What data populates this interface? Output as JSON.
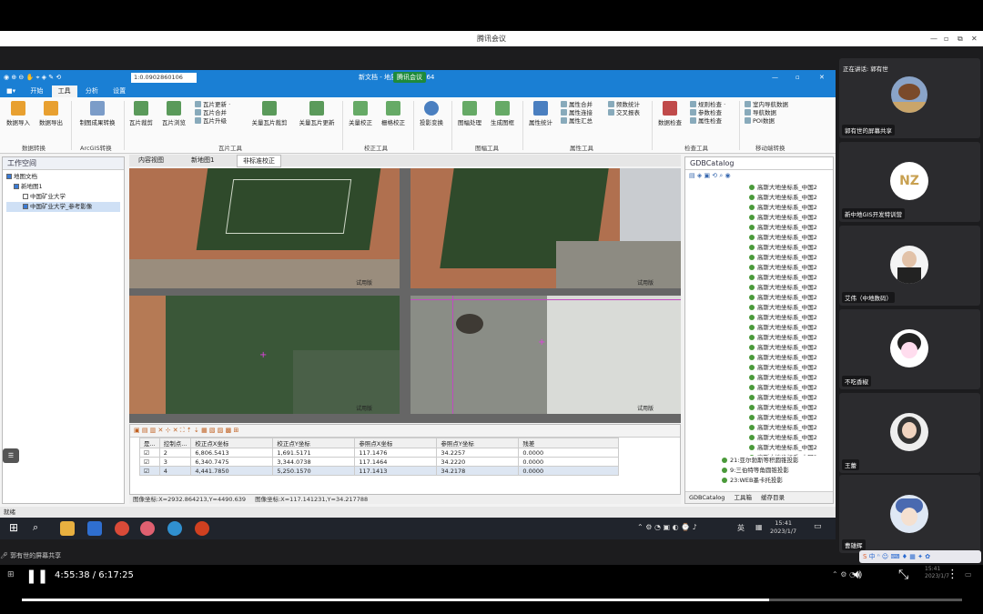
{
  "meeting": {
    "title": "腾讯会议",
    "controls": [
      "—",
      "▫",
      "⧉",
      "✕"
    ]
  },
  "gis": {
    "title": "新文档 - 地质 影像 迅 X64",
    "overlay_badge": "腾讯会议",
    "scale_value": "1:0.0902860106",
    "tabs": [
      "开始",
      "工具",
      "分析",
      "设置"
    ],
    "ribbon": {
      "groups": [
        {
          "label": "数据转换",
          "buttons": [
            "数据导入",
            "数据导出"
          ]
        },
        {
          "label": "ArcGIS转换",
          "buttons": [
            "制图成果转换"
          ]
        },
        {
          "label": "瓦片工具",
          "buttons": [
            "瓦片裁剪",
            "瓦片浏览"
          ],
          "small": [
            "瓦片更新 ·",
            "瓦片合并",
            "瓦片升级"
          ]
        },
        {
          "label": "",
          "buttons": [
            "关量瓦片裁剪",
            "关量瓦片更新"
          ]
        },
        {
          "label": "校正工具",
          "buttons": [
            "关量校正",
            "栅格校正"
          ]
        },
        {
          "label": "",
          "buttons": [
            "投影变换"
          ]
        },
        {
          "label": "图幅工具",
          "buttons": [
            "图幅处理",
            "生成图框"
          ]
        },
        {
          "label": "属性工具",
          "buttons": [
            "属性统计"
          ],
          "small": [
            "属性合并",
            "属性连接",
            "属性汇总"
          ],
          "small2": [
            "频数统计",
            "交叉报表"
          ]
        },
        {
          "label": "检查工具",
          "buttons": [
            "数据检查"
          ],
          "small": [
            "规则检查 ·",
            "参数检查",
            "属性检查"
          ]
        },
        {
          "label": "移动端转换",
          "small": [
            "室内导航数据",
            "导航数据",
            "POI数据"
          ]
        }
      ]
    },
    "workspace": {
      "title": "工作空间",
      "items": [
        "地图文档",
        "新地图1",
        "中国矿业大学",
        "中国矿业大学_参考影像"
      ]
    },
    "doc_tabs": [
      "内容视图",
      "新地图1",
      "非标准校正"
    ],
    "views": {
      "watermark": "试用版"
    },
    "gcp_table": {
      "headers": [
        "是...",
        "控制点...",
        "校正点X坐标",
        "校正点Y坐标",
        "参照点X坐标",
        "参照点Y坐标",
        "残差"
      ],
      "rows": [
        [
          "☑",
          "2",
          "6,806.5413",
          "1,691.5171",
          "117.1476",
          "34.2257",
          "0.0000"
        ],
        [
          "☑",
          "3",
          "6,340.7475",
          "3,344.0738",
          "117.1464",
          "34.2220",
          "0.0000"
        ],
        [
          "☑",
          "4",
          "4,441.7850",
          "5,250.1570",
          "117.1413",
          "34.2178",
          "0.0000"
        ]
      ]
    },
    "coords": {
      "image": "图像坐标:X=2932.864213,Y=4490.639",
      "map": "图像坐标:X=117.141231,Y=34.217788"
    },
    "status": "就绪",
    "catalog": {
      "title": "GDBCatalog",
      "items": [
        "高斯大地坐标系_中国2",
        "高斯大地坐标系_中国2",
        "高斯大地坐标系_中国2",
        "高斯大地坐标系_中国2",
        "高斯大地坐标系_中国2",
        "高斯大地坐标系_中国2",
        "高斯大地坐标系_中国2",
        "高斯大地坐标系_中国2",
        "高斯大地坐标系_中国2",
        "高斯大地坐标系_中国2",
        "高斯大地坐标系_中国2",
        "高斯大地坐标系_中国2",
        "高斯大地坐标系_中国2",
        "高斯大地坐标系_中国2",
        "高斯大地坐标系_中国2",
        "高斯大地坐标系_中国2",
        "高斯大地坐标系_中国2",
        "高斯大地坐标系_中国2",
        "高斯大地坐标系_中国2",
        "高斯大地坐标系_中国2",
        "高斯大地坐标系_中国2",
        "高斯大地坐标系_中国2",
        "高斯大地坐标系_中国2",
        "高斯大地坐标系_中国2",
        "高斯大地坐标系_中国2",
        "高斯大地坐标系_中国2",
        "高斯大地坐标系_中国2",
        "高斯大地坐标系_中国2"
      ],
      "groups": [
        "21:亚尔勃斯等积圆锥投影",
        "9:三伯特等角圆锥投影",
        "23:WEB墨卡托投影"
      ],
      "tabs": [
        "GDBCatalog",
        "工具箱",
        "缓存目录"
      ]
    }
  },
  "taskbar": {
    "time": "15:41",
    "date": "2023/1/7",
    "lang": "英"
  },
  "share_notice": "郭有世的屏幕共享",
  "participants": [
    {
      "name": "郭有世的屏幕共享",
      "speaking": "正在讲话: 郭有世"
    },
    {
      "name": "新中地GIS开发特训营"
    },
    {
      "name": "艾伟（中地数码）"
    },
    {
      "name": "不吃香椒"
    },
    {
      "name": "王蕾"
    },
    {
      "name": "曹雄辉"
    }
  ],
  "player": {
    "time": "4:55:38 / 6:17:25",
    "progress": 0.795,
    "mini_time": "15:41",
    "mini_date": "2023/1/7"
  }
}
